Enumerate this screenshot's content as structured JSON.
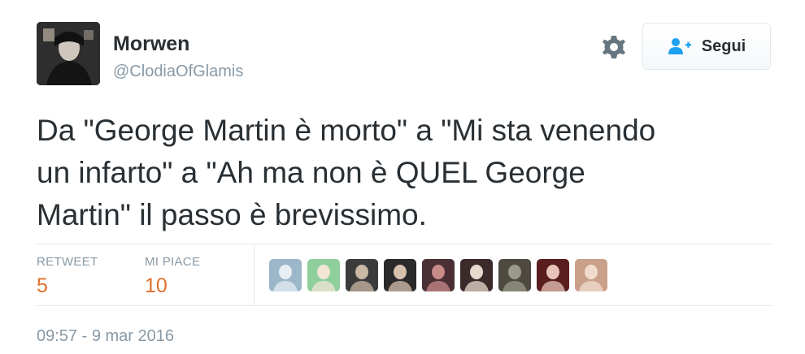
{
  "user": {
    "display_name": "Morwen",
    "handle": "@ClodiaOfGlamis",
    "avatar_icon": "user-avatar-portrait"
  },
  "header": {
    "settings_icon": "gear-icon",
    "follow_button": {
      "label": "Segui",
      "icon": "follow-person-plus-icon",
      "icon_color": "#1da1f2"
    }
  },
  "tweet": {
    "lines": [
      "Da \"George Martin è morto\" a \"Mi sta venendo",
      "un infarto\" a \"Ah ma non è QUEL George",
      "Martin\" il passo è brevissimo."
    ]
  },
  "stats": {
    "retweet_label": "RETWEET",
    "retweet_count": "5",
    "likes_label": "MI PIACE",
    "likes_count": "10",
    "count_color": "#e0712e"
  },
  "likers": [
    {
      "name": "liker-avatar-1",
      "bg": "#9bb7c9",
      "fg": "#e6eef3"
    },
    {
      "name": "liker-avatar-2",
      "bg": "#8fcf9c",
      "fg": "#f3e6d6"
    },
    {
      "name": "liker-avatar-3",
      "bg": "#3b3b3b",
      "fg": "#c9b8a4"
    },
    {
      "name": "liker-avatar-4",
      "bg": "#2a2a2a",
      "fg": "#d8c1ad"
    },
    {
      "name": "liker-avatar-5",
      "bg": "#4a2f35",
      "fg": "#c98a8a"
    },
    {
      "name": "liker-avatar-6",
      "bg": "#3a2a2a",
      "fg": "#e8d9cf"
    },
    {
      "name": "liker-avatar-7",
      "bg": "#4f4a3f",
      "fg": "#9a9a8a"
    },
    {
      "name": "liker-avatar-8",
      "bg": "#5a1e1e",
      "fg": "#e7c6b8"
    },
    {
      "name": "liker-avatar-9",
      "bg": "#caa08a",
      "fg": "#f1ddd0"
    }
  ],
  "meta": {
    "timestamp": "09:57 - 9 mar 2016"
  }
}
